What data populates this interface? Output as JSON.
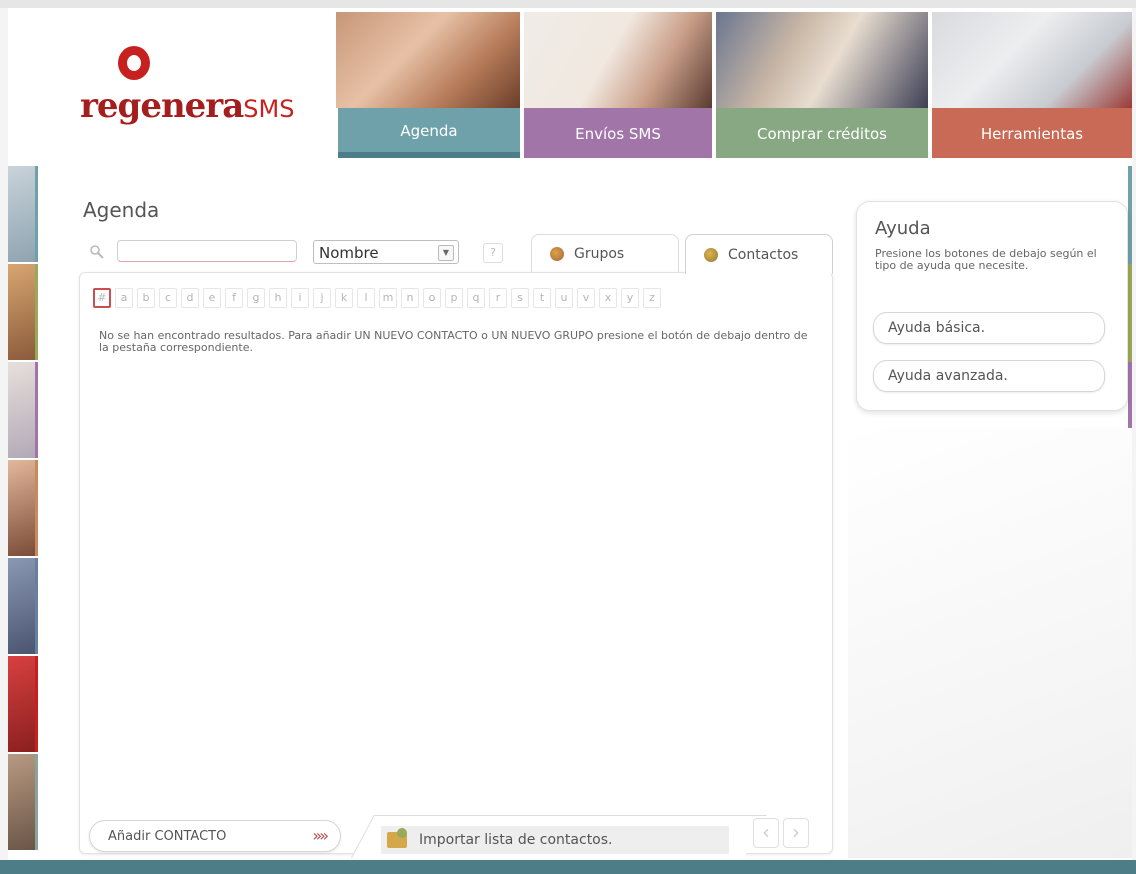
{
  "brand": {
    "logo_main": "regenera",
    "logo_accent": "SMS"
  },
  "nav": {
    "tabs": [
      {
        "label": "Agenda",
        "color": "#6fa1aa"
      },
      {
        "label": "Envíos SMS",
        "color": "#a175a8"
      },
      {
        "label": "Comprar créditos",
        "color": "#87a882"
      },
      {
        "label": "Herramientas",
        "color": "#c96a56"
      }
    ]
  },
  "main": {
    "title": "Agenda",
    "search": {
      "value": "",
      "placeholder": ""
    },
    "filter_select": "Nombre",
    "help_label": "?",
    "tabs": [
      {
        "label": "Grupos",
        "icon": "group-icon"
      },
      {
        "label": "Contactos",
        "icon": "contact-icon"
      }
    ],
    "alphabet": [
      "#",
      "a",
      "b",
      "c",
      "d",
      "e",
      "f",
      "g",
      "h",
      "i",
      "j",
      "k",
      "l",
      "m",
      "n",
      "o",
      "p",
      "q",
      "r",
      "s",
      "t",
      "u",
      "v",
      "x",
      "y",
      "z"
    ],
    "message": "No se han encontrado resultados. Para añadir UN NUEVO CONTACTO o UN NUEVO GRUPO presione el botón de debajo dentro de la pestaña correspondiente.",
    "add_button": "Añadir CONTACTO",
    "add_button_arrows": "»»",
    "import_label": "Importar lista de contactos.",
    "prev_label": "‹",
    "next_label": "›"
  },
  "help": {
    "title": "Ayuda",
    "text": "Presione los botones de debajo según el tipo de ayuda que necesite.",
    "basic_button": "Ayuda básica.",
    "advanced_button": "Ayuda avanzada."
  },
  "colors": {
    "accent_teal": "#4d7d86",
    "brand_red": "#c7211f"
  }
}
